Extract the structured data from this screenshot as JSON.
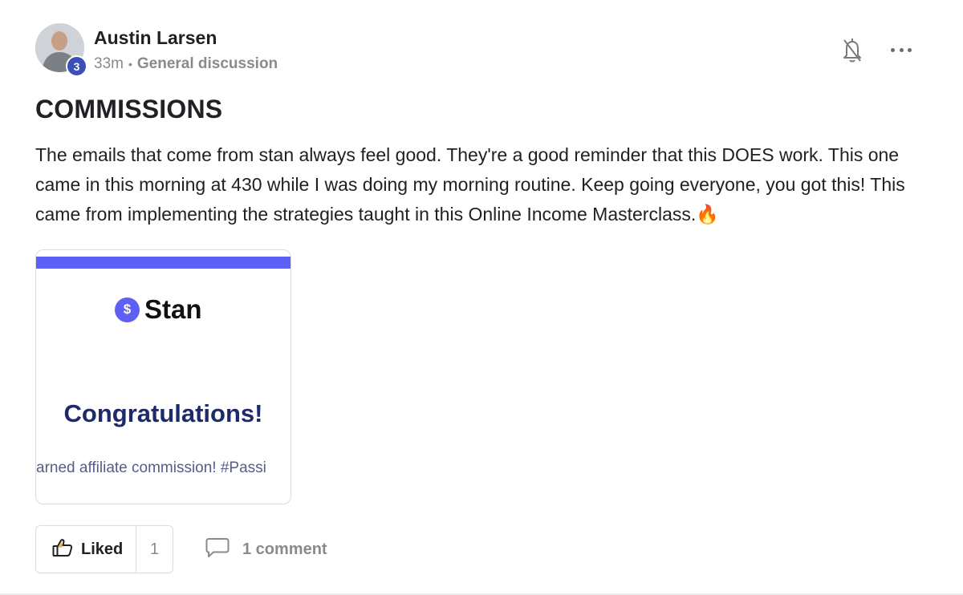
{
  "post": {
    "author": "Austin Larsen",
    "level": "3",
    "time_ago": "33m",
    "separator": "•",
    "category": "General discussion",
    "title": "COMMISSIONS",
    "body": "The emails that come from stan always feel good. They're a good reminder that this DOES work. This one came in this morning at 430 while I was doing my morning routine. Keep going everyone, you got this! This came from implementing the strategies taught in this Online Income Masterclass.🔥"
  },
  "attachment": {
    "brand_symbol": "$",
    "brand_name": "Stan",
    "headline": "Congratulations!",
    "subtext": "arned affiliate commission! #Passi",
    "accent_color": "#5d5ff5",
    "headline_color": "#1f2a6b"
  },
  "actions": {
    "like_label": "Liked",
    "like_count": "1",
    "comment_label": "1 comment"
  },
  "icons": {
    "notification": "bell-off-icon",
    "menu": "more-horizontal-icon",
    "like": "thumbs-up-icon",
    "comment": "comment-bubble-icon"
  },
  "colors": {
    "level_badge": "#3b4fb8",
    "muted_text": "#8a8a8a"
  }
}
